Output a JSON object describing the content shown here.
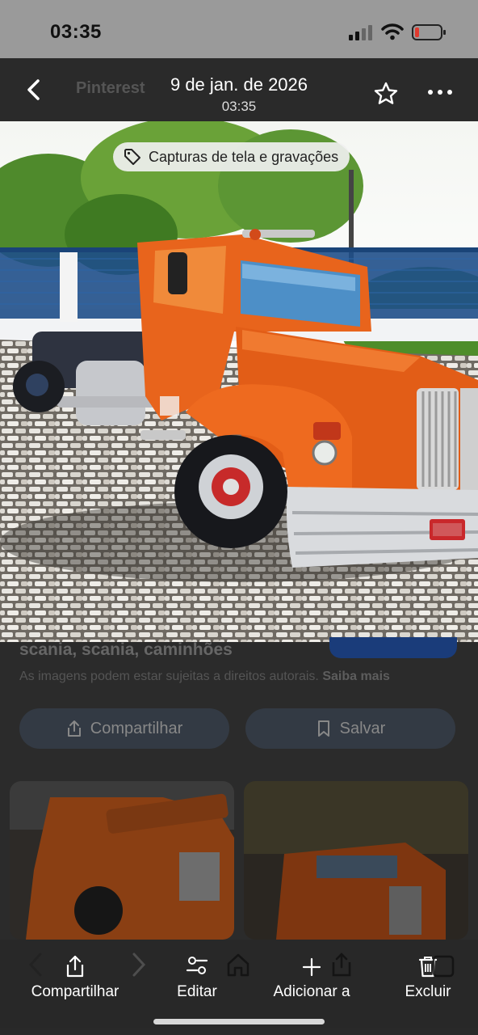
{
  "status_bar": {
    "time": "03:35",
    "icons": [
      "cellular-signal-icon",
      "wifi-icon",
      "battery-low-icon"
    ],
    "battery_color": "#e03a2f"
  },
  "viewer": {
    "app_behind": "Pinterest",
    "date": "9 de jan. de 2026",
    "time": "03:35",
    "chip_label": "Capturas de tela e gravações"
  },
  "pinterest_page": {
    "title": "scania, scania, caminhões",
    "copyright_note": "As imagens podem estar sujeitas a direitos autorais.",
    "learn_more": "Saiba mais",
    "share_label": "Compartilhar",
    "save_label": "Salvar"
  },
  "bottom_actions": [
    {
      "label": "Compartilhar",
      "icon": "share-icon"
    },
    {
      "label": "Editar",
      "icon": "edit-sliders-icon"
    },
    {
      "label": "Adicionar a",
      "icon": "plus-icon"
    },
    {
      "label": "Excluir",
      "icon": "trash-icon"
    }
  ],
  "colors": {
    "truck_orange": "#e8641c",
    "topbar_bg": "#2a2a2a",
    "pinterest_blue": "#1a3c7a"
  }
}
